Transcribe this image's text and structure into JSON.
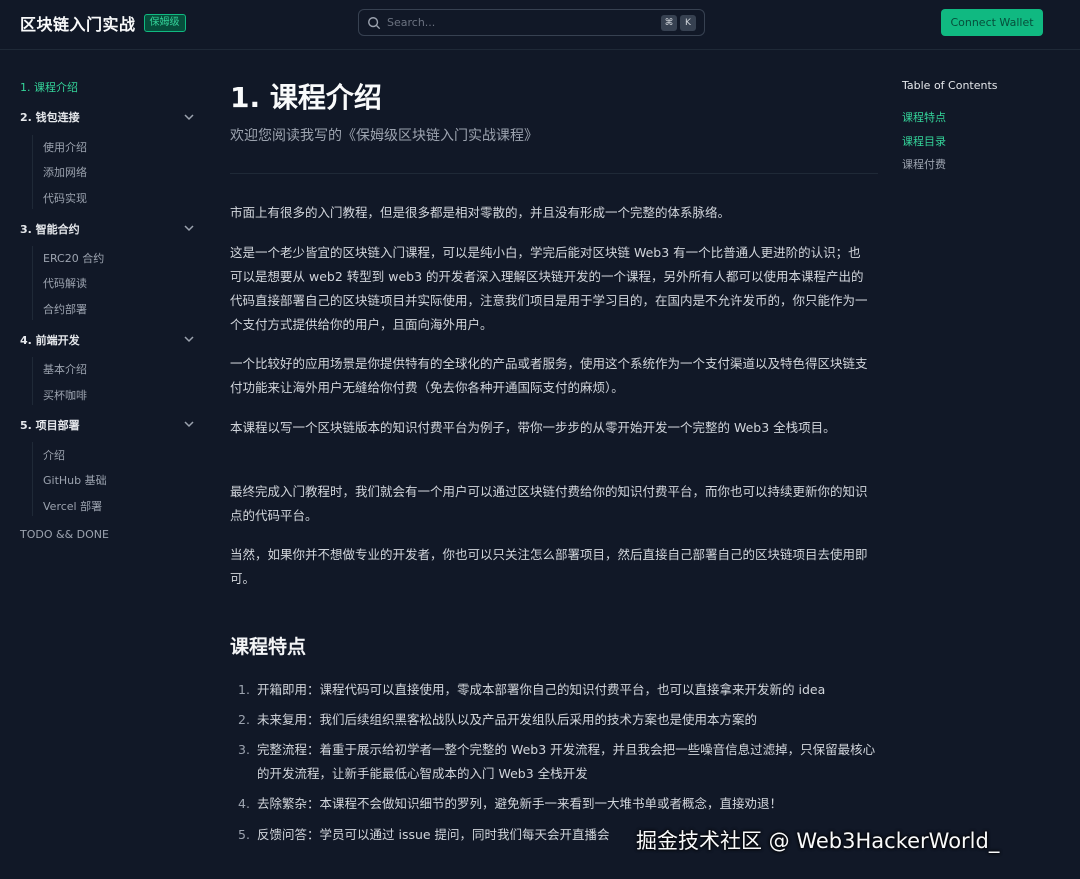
{
  "header": {
    "title": "区块链入门实战",
    "badge": "保姆级",
    "search_placeholder": "Search...",
    "kbd_cmd": "⌘",
    "kbd_k": "K",
    "connect_label": "Connect Wallet"
  },
  "sidebar": {
    "s1": "1. 课程介绍",
    "s2": "2. 钱包连接",
    "s2_items": [
      "使用介绍",
      "添加网络",
      "代码实现"
    ],
    "s3": "3. 智能合约",
    "s3_items": [
      "ERC20 合约",
      "代码解读",
      "合约部署"
    ],
    "s4": "4. 前端开发",
    "s4_items": [
      "基本介绍",
      "买杯咖啡"
    ],
    "s5": "5. 项目部署",
    "s5_items": [
      "介绍",
      "GitHub 基础",
      "Vercel 部署"
    ],
    "todo": "TODO && DONE"
  },
  "main": {
    "title": "1. 课程介绍",
    "subtitle": "欢迎您阅读我写的《保姆级区块链入门实战课程》",
    "paragraphs": [
      "市面上有很多的入门教程，但是很多都是相对零散的，并且没有形成一个完整的体系脉络。",
      "这是一个老少皆宜的区块链入门课程，可以是纯小白，学完后能对区块链 Web3 有一个比普通人更进阶的认识；也可以是想要从 web2 转型到 web3 的开发者深入理解区块链开发的一个课程，另外所有人都可以使用本课程产出的代码直接部署自己的区块链项目并实际使用，注意我们项目是用于学习目的，在国内是不允许发币的，你只能作为一个支付方式提供给你的用户，且面向海外用户。",
      "一个比较好的应用场景是你提供特有的全球化的产品或者服务，使用这个系统作为一个支付渠道以及特色得区块链支付功能来让海外用户无缝给你付费（免去你各种开通国际支付的麻烦）。",
      "本课程以写一个区块链版本的知识付费平台为例子，带你一步步的从零开始开发一个完整的 Web3 全栈项目。",
      "最终完成入门教程时，我们就会有一个用户可以通过区块链付费给你的知识付费平台，而你也可以持续更新你的知识点的代码平台。",
      "当然，如果你并不想做专业的开发者，你也可以只关注怎么部署项目，然后直接自己部署自己的区块链项目去使用即可。"
    ],
    "features_heading": "课程特点",
    "features": [
      {
        "num": "1.",
        "text": "开箱即用：课程代码可以直接使用，零成本部署你自己的知识付费平台，也可以直接拿来开发新的 idea"
      },
      {
        "num": "2.",
        "text": "未来复用：我们后续组织黑客松战队以及产品开发组队后采用的技术方案也是使用本方案的"
      },
      {
        "num": "3.",
        "text": "完整流程：着重于展示给初学者一整个完整的 Web3 开发流程，并且我会把一些噪音信息过滤掉，只保留最核心的开发流程，让新手能最低心智成本的入门 Web3 全栈开发"
      },
      {
        "num": "4.",
        "text": "去除繁杂：本课程不会做知识细节的罗列，避免新手一来看到一大堆书单或者概念，直接劝退！"
      },
      {
        "num": "5.",
        "text": "反馈问答：学员可以通过 issue 提问，同时我们每天会开直播会"
      }
    ]
  },
  "toc": {
    "title": "Table of Contents",
    "items": [
      "课程特点",
      "课程目录",
      "课程付费"
    ]
  },
  "watermark": "掘金技术社区 @ Web3HackerWorld_",
  "colors": {
    "accent": "#10b981",
    "background": "#111827"
  }
}
